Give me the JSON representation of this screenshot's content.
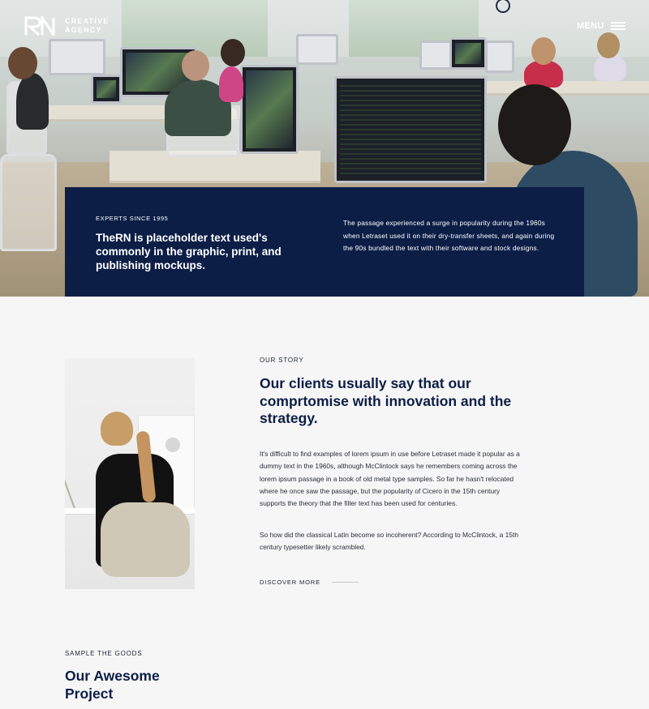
{
  "brand": {
    "name_line1": "CREATIVE",
    "name_line2": "AGENCY",
    "logo_letters": "RN"
  },
  "nav": {
    "menu_label": "MENU"
  },
  "hero": {
    "eyebrow": "EXPERTS SINCE 1995",
    "headline": "TheRN is placeholder text used's commonly in the graphic, print, and publishing mockups.",
    "description": "The passage experienced a surge in popularity during the 1960s when Letraset used it on their dry-transfer sheets, and again during the 90s bundled the text with their software and stock designs."
  },
  "story": {
    "eyebrow": "OUR STORY",
    "title": "Our clients usually say that our comprtomise with innovation and the strategy.",
    "paragraph1": "It's difficult to find examples of lorem ipsum in use before Letraset made it popular as a dummy text in the 1960s, although McClintock says he remembers coming across the lorem ipsum passage in a book of old metal type samples. So far he hasn't relocated where he once saw the passage, but the popularity of Cicero in the 15th century supports the theory that the filler text has been used for centuries.",
    "paragraph2": "So how did the classical Latin become so incoherent? According to McClintock, a 15th century typesetter likely scrambled.",
    "cta_label": "DISCOVER MORE"
  },
  "projects": {
    "eyebrow": "SAMPLE THE GOODS",
    "title": "Our Awesome Project"
  },
  "colors": {
    "navy": "#0c1e46",
    "background": "#f6f6f6"
  }
}
